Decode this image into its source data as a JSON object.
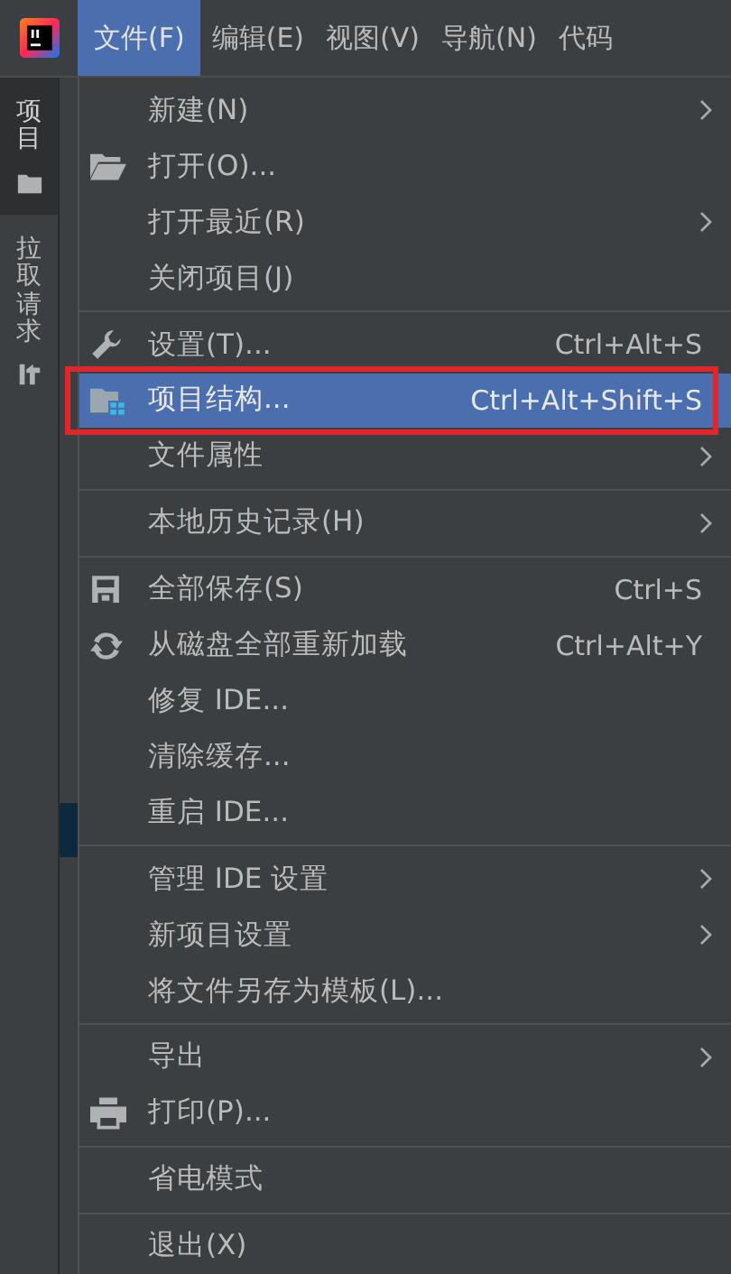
{
  "menubar": [
    {
      "label": "文件(F)",
      "selected": true
    },
    {
      "label": "编辑(E)",
      "selected": false
    },
    {
      "label": "视图(V)",
      "selected": false
    },
    {
      "label": "导航(N)",
      "selected": false
    },
    {
      "label": "代码",
      "selected": false
    }
  ],
  "tool_tabs": [
    {
      "label": "项目",
      "kind": "folder",
      "selected": true
    },
    {
      "label": "拉取请求",
      "kind": "pull",
      "selected": false
    }
  ],
  "menu": [
    [
      {
        "label": "新建(N)",
        "kind": "plain",
        "submenu": true
      },
      {
        "label": "打开(O)...",
        "kind": "open",
        "submenu": false
      },
      {
        "label": "打开最近(R)",
        "kind": "plain",
        "submenu": true
      },
      {
        "label": "关闭项目(J)",
        "kind": "plain",
        "submenu": false
      }
    ],
    [
      {
        "label": "设置(T)...",
        "kind": "settings",
        "shortcut": "Ctrl+Alt+S",
        "submenu": false
      },
      {
        "label": "项目结构...",
        "kind": "structure",
        "shortcut": "Ctrl+Alt+Shift+S",
        "submenu": false,
        "selected": true,
        "highlighted": true
      },
      {
        "label": "文件属性",
        "kind": "plain",
        "submenu": true
      }
    ],
    [
      {
        "label": "本地历史记录(H)",
        "kind": "plain",
        "submenu": true
      }
    ],
    [
      {
        "label": "全部保存(S)",
        "kind": "save",
        "shortcut": "Ctrl+S",
        "submenu": false
      },
      {
        "label": "从磁盘全部重新加载",
        "kind": "reload",
        "shortcut": "Ctrl+Alt+Y",
        "submenu": false
      },
      {
        "label": "修复 IDE...",
        "kind": "plain",
        "submenu": false
      },
      {
        "label": "清除缓存...",
        "kind": "plain",
        "submenu": false
      },
      {
        "label": "重启 IDE...",
        "kind": "plain",
        "submenu": false
      }
    ],
    [
      {
        "label": "管理 IDE 设置",
        "kind": "plain",
        "submenu": true
      },
      {
        "label": "新项目设置",
        "kind": "plain",
        "submenu": true
      },
      {
        "label": "将文件另存为模板(L)...",
        "kind": "plain",
        "submenu": false
      }
    ],
    [
      {
        "label": "导出",
        "kind": "plain",
        "submenu": true
      },
      {
        "label": "打印(P)...",
        "kind": "print",
        "submenu": false
      }
    ],
    [
      {
        "label": "省电模式",
        "kind": "plain",
        "submenu": false
      }
    ],
    [
      {
        "label": "退出(X)",
        "kind": "plain",
        "submenu": false
      }
    ]
  ]
}
